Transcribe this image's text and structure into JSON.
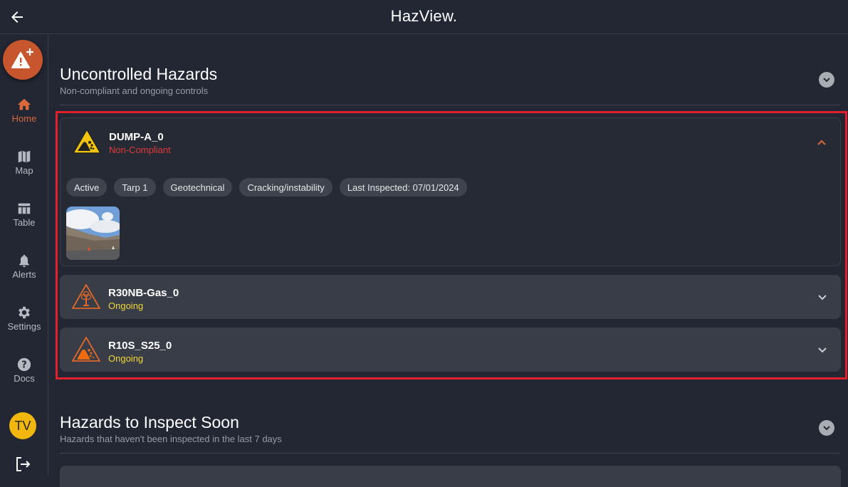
{
  "app": {
    "title": "HazView."
  },
  "sidebar": {
    "items": [
      {
        "label": "Home",
        "icon": "home-icon",
        "active": true
      },
      {
        "label": "Map",
        "icon": "map-icon",
        "active": false
      },
      {
        "label": "Table",
        "icon": "table-icon",
        "active": false
      },
      {
        "label": "Alerts",
        "icon": "bell-icon",
        "active": false
      },
      {
        "label": "Settings",
        "icon": "gear-icon",
        "active": false
      },
      {
        "label": "Docs",
        "icon": "help-icon",
        "active": false
      }
    ],
    "user_initials": "TV",
    "fab_icon": "add-hazard-icon",
    "logout_icon": "logout-icon"
  },
  "sections": [
    {
      "title": "Uncontrolled Hazards",
      "subtitle": "Non-compliant and ongoing controls",
      "hazards": [
        {
          "name": "DUMP-A_0",
          "status": "Non-Compliant",
          "status_color": "#e03a3a",
          "icon": "rockfall-warning-icon",
          "expanded": true,
          "tags": [
            "Active",
            "Tarp 1",
            "Geotechnical",
            "Cracking/instability",
            "Last Inspected: 07/01/2024"
          ]
        },
        {
          "name": "R30NB-Gas_0",
          "status": "Ongoing",
          "status_color": "#f0d43a",
          "icon": "gas-explosion-warning-icon",
          "expanded": false
        },
        {
          "name": "R10S_S25_0",
          "status": "Ongoing",
          "status_color": "#f0d43a",
          "icon": "rockfall-warning-icon",
          "expanded": false
        }
      ]
    },
    {
      "title": "Hazards to Inspect Soon",
      "subtitle": "Hazards that haven't been inspected in the last 7 days"
    }
  ],
  "colors": {
    "accent": "#d9683b",
    "highlight": "#e0202c",
    "background": "#222733",
    "card": "#393d47"
  }
}
